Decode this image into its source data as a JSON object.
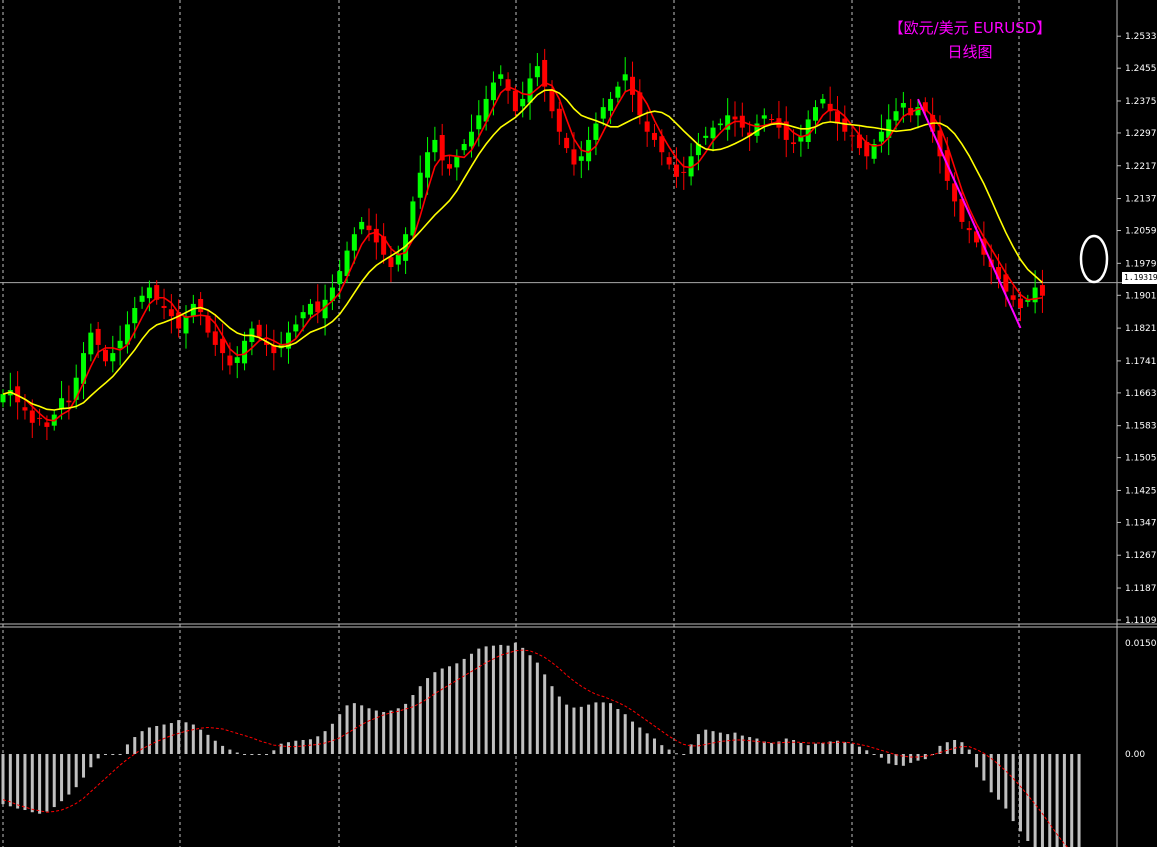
{
  "chart_title": {
    "line1": "【欧元/美元 EURUSD】",
    "line2": "日线图"
  },
  "current_price_label": "1.19319",
  "colors": {
    "background": "#000000",
    "bull_candle": "#00ff00",
    "bear_candle": "#ff0000",
    "ma_fast": "#ff0000",
    "ma_slow": "#ffff00",
    "trendline": "#ff00ff",
    "macd_histogram": "#c0c0c0",
    "macd_signal": "#ff0000",
    "grid": "#ffffff",
    "title": "#ff00ff"
  },
  "chart_data": [
    {
      "type": "candlestick",
      "panel": "price",
      "symbol": "EURUSD",
      "timeframe": "daily",
      "y_ticks": [
        "1.25330",
        "1.24550",
        "1.23750",
        "1.22970",
        "1.22170",
        "1.21370",
        "1.20590",
        "1.19790",
        "1.19010",
        "1.18210",
        "1.17410",
        "1.16630",
        "1.15830",
        "1.15050",
        "1.14250",
        "1.13470",
        "1.12670",
        "1.11870",
        "1.11090"
      ],
      "ylim": [
        1.1109,
        1.2553
      ],
      "current_price": 1.19319,
      "grid": "vertical dashed",
      "closes": [
        1.166,
        1.167,
        1.164,
        1.162,
        1.159,
        1.16,
        1.158,
        1.161,
        1.165,
        1.164,
        1.17,
        1.176,
        1.181,
        1.178,
        1.174,
        1.176,
        1.179,
        1.183,
        1.187,
        1.19,
        1.192,
        1.189,
        1.187,
        1.185,
        1.182,
        1.185,
        1.188,
        1.186,
        1.181,
        1.178,
        1.176,
        1.173,
        1.175,
        1.179,
        1.182,
        1.18,
        1.178,
        1.176,
        1.178,
        1.181,
        1.183,
        1.186,
        1.188,
        1.186,
        1.189,
        1.192,
        1.196,
        1.201,
        1.205,
        1.208,
        1.206,
        1.203,
        1.2,
        1.197,
        1.2,
        1.205,
        1.213,
        1.22,
        1.225,
        1.228,
        1.223,
        1.221,
        1.224,
        1.227,
        1.23,
        1.234,
        1.238,
        1.242,
        1.244,
        1.24,
        1.235,
        1.238,
        1.243,
        1.246,
        1.241,
        1.235,
        1.23,
        1.226,
        1.222,
        1.224,
        1.228,
        1.232,
        1.236,
        1.238,
        1.241,
        1.244,
        1.239,
        1.234,
        1.23,
        1.228,
        1.225,
        1.222,
        1.219,
        1.22,
        1.224,
        1.227,
        1.229,
        1.231,
        1.232,
        1.234,
        1.233,
        1.231,
        1.229,
        1.232,
        1.234,
        1.233,
        1.231,
        1.228,
        1.227,
        1.229,
        1.233,
        1.236,
        1.238,
        1.235,
        1.232,
        1.23,
        1.229,
        1.226,
        1.224,
        1.227,
        1.23,
        1.233,
        1.235,
        1.237,
        1.234,
        1.236,
        1.235,
        1.23,
        1.224,
        1.218,
        1.213,
        1.208,
        1.206,
        1.203,
        1.2,
        1.197,
        1.194,
        1.191,
        1.189,
        1.187,
        1.189,
        1.192,
        1.19
      ],
      "series": [
        {
          "name": "",
          "kind": "moving-average",
          "color": "#ff0000"
        },
        {
          "name": "",
          "kind": "moving-average",
          "color": "#ffff00"
        },
        {
          "name": "",
          "kind": "trendline",
          "color": "#ff00ff"
        }
      ]
    },
    {
      "type": "bar",
      "panel": "oscillator",
      "y_ticks": [
        "0.01506",
        "0.00"
      ],
      "ylim": [
        -0.018,
        0.01506
      ],
      "values": [
        -0.0068,
        -0.0071,
        -0.0074,
        -0.0076,
        -0.0079,
        -0.0081,
        -0.0078,
        -0.0072,
        -0.0064,
        -0.0055,
        -0.0045,
        -0.0032,
        -0.0018,
        -0.0006,
        -0.0001,
        0,
        0,
        0.0013,
        0.0023,
        0.0031,
        0.0036,
        0.0038,
        0.004,
        0.0042,
        0.0046,
        0.0043,
        0.004,
        0.0033,
        0.0026,
        0.0018,
        0.0011,
        0.0006,
        0.0002,
        0,
        0,
        0,
        0,
        0.0005,
        0.0014,
        0.0016,
        0.0018,
        0.0019,
        0.002,
        0.0024,
        0.0031,
        0.0041,
        0.0054,
        0.0066,
        0.0069,
        0.0066,
        0.0062,
        0.0059,
        0.0057,
        0.0059,
        0.0062,
        0.0068,
        0.008,
        0.0092,
        0.0103,
        0.0111,
        0.0116,
        0.0119,
        0.0123,
        0.0129,
        0.0136,
        0.0143,
        0.0146,
        0.0147,
        0.0148,
        0.0147,
        0.0151,
        0.0144,
        0.0134,
        0.0124,
        0.0108,
        0.0092,
        0.0078,
        0.0067,
        0.0063,
        0.0064,
        0.0067,
        0.007,
        0.007,
        0.0069,
        0.0061,
        0.0054,
        0.0044,
        0.0036,
        0.0028,
        0.0021,
        0.0012,
        0.0006,
        0.0001,
        0,
        0.0013,
        0.0027,
        0.0033,
        0.0031,
        0.0029,
        0.0027,
        0.0029,
        0.0025,
        0.0023,
        0.0021,
        0.0017,
        0.0015,
        0.0017,
        0.0021,
        0.0019,
        0.0015,
        0.0012,
        0.0014,
        0.0015,
        0.0017,
        0.0018,
        0.0016,
        0.0014,
        0.001,
        0.0005,
        0,
        -0.0005,
        -0.0013,
        -0.0015,
        -0.0016,
        -0.0012,
        -0.0009,
        -0.0007,
        0,
        0.0011,
        0.0016,
        0.0019,
        0.0016,
        0.0006,
        -0.0018,
        -0.0036,
        -0.0052,
        -0.0062,
        -0.0074,
        -0.0091,
        -0.0105,
        -0.0118,
        -0.013,
        -0.0147,
        -0.016,
        -0.0173,
        -0.0174,
        -0.0166,
        -0.0175
      ],
      "signal": [
        -0.0062,
        -0.0065,
        -0.0069,
        -0.0072,
        -0.0075,
        -0.0077,
        -0.0079,
        -0.0078,
        -0.0076,
        -0.0072,
        -0.0067,
        -0.006,
        -0.0051,
        -0.0042,
        -0.0033,
        -0.0024,
        -0.0015,
        -0.0007,
        0,
        0.0007,
        0.0012,
        0.0017,
        0.0021,
        0.0025,
        0.0028,
        0.0031,
        0.0033,
        0.0035,
        0.0036,
        0.0035,
        0.0034,
        0.0031,
        0.0028,
        0.0025,
        0.0022,
        0.0018,
        0.0015,
        0.0012,
        0.0011,
        0.001,
        0.001,
        0.0011,
        0.0012,
        0.0013,
        0.0015,
        0.0018,
        0.0022,
        0.0028,
        0.0034,
        0.004,
        0.0045,
        0.0049,
        0.0053,
        0.0056,
        0.0058,
        0.0061,
        0.0064,
        0.0069,
        0.0075,
        0.0082,
        0.0088,
        0.0094,
        0.01,
        0.0106,
        0.0112,
        0.0118,
        0.0124,
        0.0129,
        0.0134,
        0.0137,
        0.014,
        0.0141,
        0.014,
        0.0136,
        0.0131,
        0.0124,
        0.0116,
        0.0107,
        0.0099,
        0.0092,
        0.0086,
        0.0081,
        0.0078,
        0.0074,
        0.007,
        0.0065,
        0.0059,
        0.0052,
        0.0045,
        0.0038,
        0.0031,
        0.0024,
        0.0018,
        0.0013,
        0.0011,
        0.0011,
        0.0013,
        0.0015,
        0.0017,
        0.0018,
        0.0019,
        0.0019,
        0.0018,
        0.0017,
        0.0016,
        0.0015,
        0.0015,
        0.0016,
        0.0016,
        0.0016,
        0.0015,
        0.0015,
        0.0015,
        0.0015,
        0.0016,
        0.0016,
        0.0015,
        0.0013,
        0.0011,
        0.0008,
        0.0005,
        0.0002,
        -0.0001,
        -0.0003,
        -0.0004,
        -0.0004,
        -0.0003,
        -0.0001,
        0.0002,
        0.0005,
        0.0008,
        0.001,
        0.001,
        0.0006,
        0.0001,
        -0.0006,
        -0.0014,
        -0.0023,
        -0.0033,
        -0.0044,
        -0.0056,
        -0.0068,
        -0.0081,
        -0.0095,
        -0.0109,
        -0.0122,
        -0.0133,
        -0.0142,
        -0.015
      ]
    }
  ]
}
